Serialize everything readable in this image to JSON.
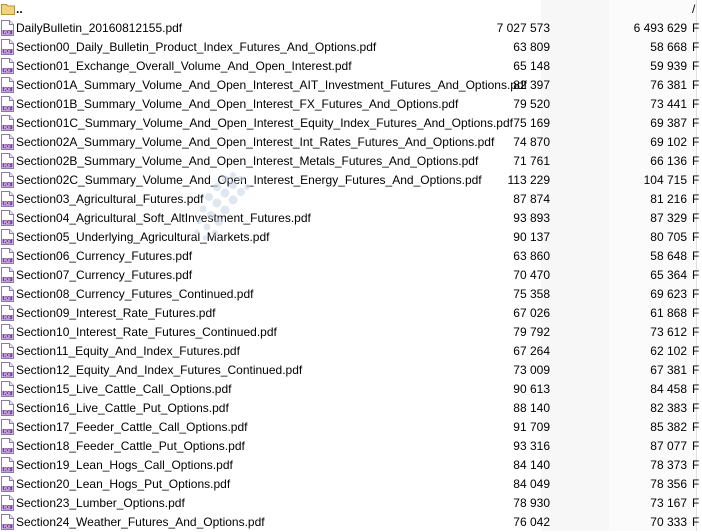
{
  "up": {
    "name": "..",
    "extra": "/"
  },
  "files": [
    {
      "name": "DailyBulletin_20160812155.pdf",
      "size": "7 027 573",
      "packed": "6 493 629",
      "extra": "F"
    },
    {
      "name": "Section00_Daily_Bulletin_Product_Index_Futures_And_Options.pdf",
      "size": "63 809",
      "packed": "58 668",
      "extra": "F"
    },
    {
      "name": "Section01_Exchange_Overall_Volume_And_Open_Interest.pdf",
      "size": "65 148",
      "packed": "59 939",
      "extra": "F"
    },
    {
      "name": "Section01A_Summary_Volume_And_Open_Interest_AIT_Investment_Futures_And_Options.pdf",
      "size": "82 397",
      "packed": "76 381",
      "extra": "F"
    },
    {
      "name": "Section01B_Summary_Volume_And_Open_Interest_FX_Futures_And_Options.pdf",
      "size": "79 520",
      "packed": "73 441",
      "extra": "F"
    },
    {
      "name": "Section01C_Summary_Volume_And_Open_Interest_Equity_Index_Futures_And_Options.pdf",
      "size": "75 169",
      "packed": "69 387",
      "extra": "F"
    },
    {
      "name": "Section02A_Summary_Volume_And_Open_Interest_Int_Rates_Futures_And_Options.pdf",
      "size": "74 870",
      "packed": "69 102",
      "extra": "F"
    },
    {
      "name": "Section02B_Summary_Volume_And_Open_Interest_Metals_Futures_And_Options.pdf",
      "size": "71 761",
      "packed": "66 136",
      "extra": "F"
    },
    {
      "name": "Section02C_Summary_Volume_And_Open_Interest_Energy_Futures_And_Options.pdf",
      "size": "113 229",
      "packed": "104 715",
      "extra": "F"
    },
    {
      "name": "Section03_Agricultural_Futures.pdf",
      "size": "87 874",
      "packed": "81 216",
      "extra": "F"
    },
    {
      "name": "Section04_Agricultural_Soft_AltInvestment_Futures.pdf",
      "size": "93 893",
      "packed": "87 329",
      "extra": "F"
    },
    {
      "name": "Section05_Underlying_Agricultural_Markets.pdf",
      "size": "90 137",
      "packed": "80 705",
      "extra": "F"
    },
    {
      "name": "Section06_Currency_Futures.pdf",
      "size": "63 860",
      "packed": "58 648",
      "extra": "F"
    },
    {
      "name": "Section07_Currency_Futures.pdf",
      "size": "70 470",
      "packed": "65 364",
      "extra": "F"
    },
    {
      "name": "Section08_Currency_Futures_Continued.pdf",
      "size": "75 358",
      "packed": "69 623",
      "extra": "F"
    },
    {
      "name": "Section09_Interest_Rate_Futures.pdf",
      "size": "67 026",
      "packed": "61 868",
      "extra": "F"
    },
    {
      "name": "Section10_Interest_Rate_Futures_Continued.pdf",
      "size": "79 792",
      "packed": "73 612",
      "extra": "F"
    },
    {
      "name": "Section11_Equity_And_Index_Futures.pdf",
      "size": "67 264",
      "packed": "62 102",
      "extra": "F"
    },
    {
      "name": "Section12_Equity_And_Index_Futures_Continued.pdf",
      "size": "73 009",
      "packed": "67 381",
      "extra": "F"
    },
    {
      "name": "Section15_Live_Cattle_Call_Options.pdf",
      "size": "90 613",
      "packed": "84 458",
      "extra": "F"
    },
    {
      "name": "Section16_Live_Cattle_Put_Options.pdf",
      "size": "88 140",
      "packed": "82 383",
      "extra": "F"
    },
    {
      "name": "Section17_Feeder_Cattle_Call_Options.pdf",
      "size": "91 709",
      "packed": "85 382",
      "extra": "F"
    },
    {
      "name": "Section18_Feeder_Cattle_Put_Options.pdf",
      "size": "93 316",
      "packed": "87 077",
      "extra": "F"
    },
    {
      "name": "Section19_Lean_Hogs_Call_Options.pdf",
      "size": "84 140",
      "packed": "78 373",
      "extra": "F"
    },
    {
      "name": "Section20_Lean_Hogs_Put_Options.pdf",
      "size": "84 049",
      "packed": "78 356",
      "extra": "F"
    },
    {
      "name": "Section23_Lumber_Options.pdf",
      "size": "78 930",
      "packed": "73 167",
      "extra": "F"
    },
    {
      "name": "Section24_Weather_Futures_And_Options.pdf",
      "size": "76 042",
      "packed": "70 333",
      "extra": "F"
    }
  ],
  "icons": {
    "file": "pdf-icon",
    "up": "folder-up-icon"
  },
  "colors": {
    "pdf_icon_accent": "#7a3fa0",
    "shade": "#f7f7f7"
  }
}
